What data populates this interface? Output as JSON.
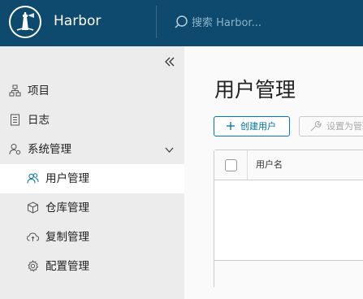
{
  "header": {
    "app_title": "Harbor",
    "search_placeholder": "搜索 Harbor...",
    "background": "#0d4a6e"
  },
  "sidebar": {
    "items": [
      {
        "label": "项目",
        "icon": "project-icon"
      },
      {
        "label": "日志",
        "icon": "log-icon"
      },
      {
        "label": "系统管理",
        "icon": "admin-icon",
        "expanded": true
      },
      {
        "label": "用户管理",
        "icon": "users-icon",
        "active": true
      },
      {
        "label": "仓库管理",
        "icon": "registry-icon"
      },
      {
        "label": "复制管理",
        "icon": "replication-icon"
      },
      {
        "label": "配置管理",
        "icon": "config-icon"
      }
    ]
  },
  "main": {
    "title": "用户管理",
    "create_user_label": "创建用户",
    "set_admin_label": "设置为管理员",
    "grid": {
      "columns": [
        "用户名"
      ]
    }
  },
  "colors": {
    "accent": "#0079b8",
    "active_icon": "#0072a3"
  }
}
